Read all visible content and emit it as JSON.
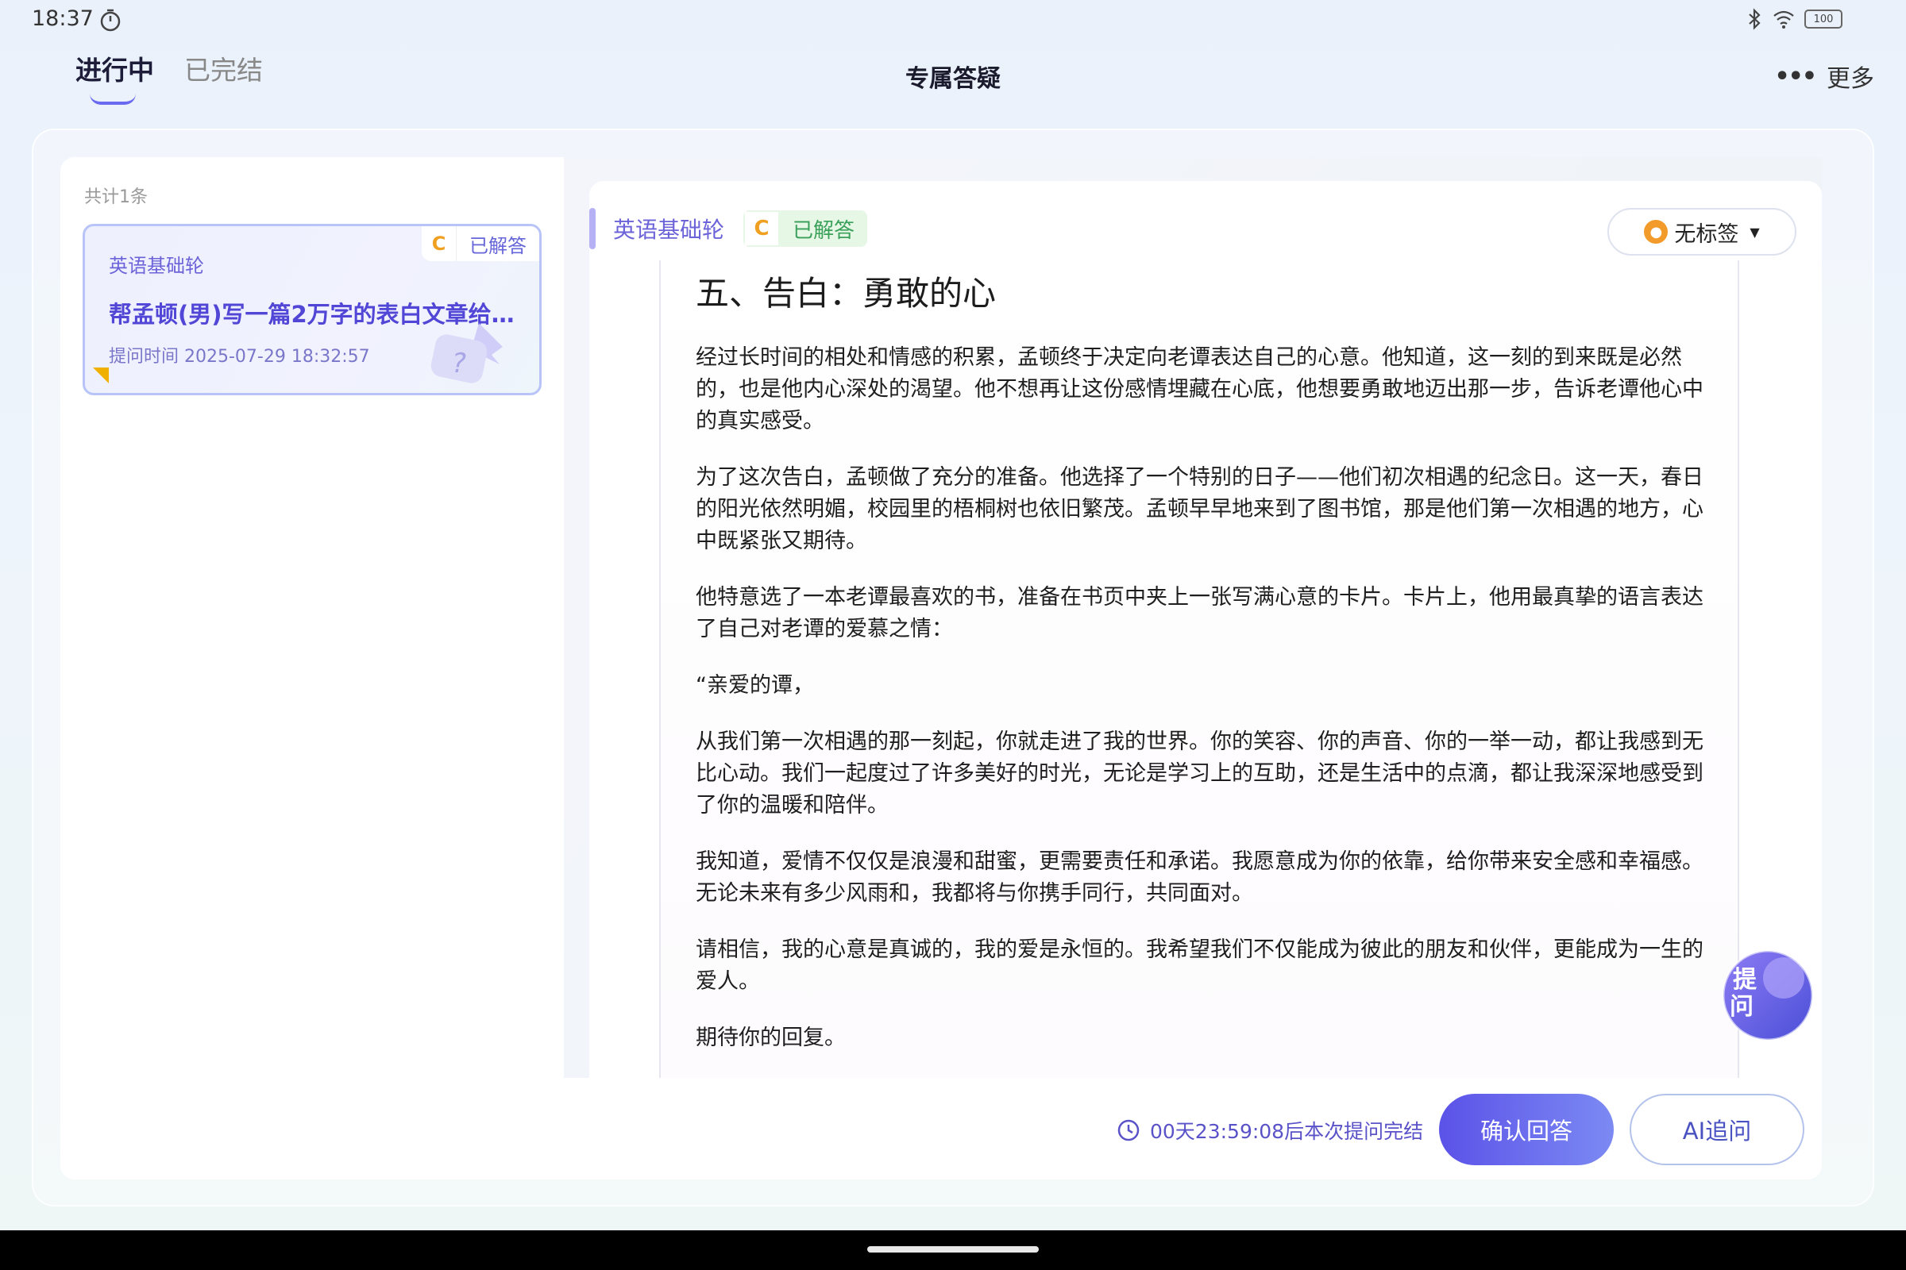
{
  "status_bar": {
    "time": "18:37",
    "battery": "100"
  },
  "header": {
    "tabs": [
      {
        "label": "进行中",
        "active": true
      },
      {
        "label": "已完结",
        "active": false
      }
    ],
    "title": "专属答疑",
    "more_label": "更多"
  },
  "list": {
    "total": "共计1条",
    "items": [
      {
        "course": "英语基础轮",
        "grade": "C",
        "status": "已解答",
        "title": "帮孟顿(男)写一篇2万字的表白文章给…",
        "time": "提问时间 2025-07-29 18:32:57"
      }
    ]
  },
  "answer": {
    "course": "英语基础轮",
    "grade": "C",
    "status": "已解答",
    "tag_label": "无标签",
    "heading": "五、告白：勇敢的心",
    "paragraphs": [
      "经过长时间的相处和情感的积累，孟顿终于决定向老谭表达自己的心意。他知道，这一刻的到来既是必然的，也是他内心深处的渴望。他不想再让这份感情埋藏在心底，他想要勇敢地迈出那一步，告诉老谭他心中的真实感受。",
      "为了这次告白，孟顿做了充分的准备。他选择了一个特别的日子——他们初次相遇的纪念日。这一天，春日的阳光依然明媚，校园里的梧桐树也依旧繁茂。孟顿早早地来到了图书馆，那是他们第一次相遇的地方，心中既紧张又期待。",
      "他特意选了一本老谭最喜欢的书，准备在书页中夹上一张写满心意的卡片。卡片上，他用最真挚的语言表达了自己对老谭的爱慕之情：",
      "“亲爱的谭，",
      "从我们第一次相遇的那一刻起，你就走进了我的世界。你的笑容、你的声音、你的一举一动，都让我感到无比心动。我们一起度过了许多美好的时光，无论是学习上的互助，还是生活中的点滴，都让我深深地感受到了你的温暖和陪伴。",
      "我知道，爱情不仅仅是浪漫和甜蜜，更需要责任和承诺。我愿意成为你的依靠，给你带来安全感和幸福感。无论未来有多少风雨和，我都将与你携手同行，共同面对。",
      "请相信，我的心意是真诚的，我的爱是永恒的。我希望我们不仅能成为彼此的朋友和伙伴，更能成为一生的爱人。",
      "期待你的回复。"
    ],
    "ask_label_1": "提",
    "ask_label_2": "问"
  },
  "footer": {
    "countdown": "00天23:59:08后本次提问完结",
    "confirm_label": "确认回答",
    "ai_label": "AI追问"
  },
  "colors": {
    "accent": "#5b52e8",
    "success": "#3aa05a",
    "grade": "#f0a020"
  }
}
